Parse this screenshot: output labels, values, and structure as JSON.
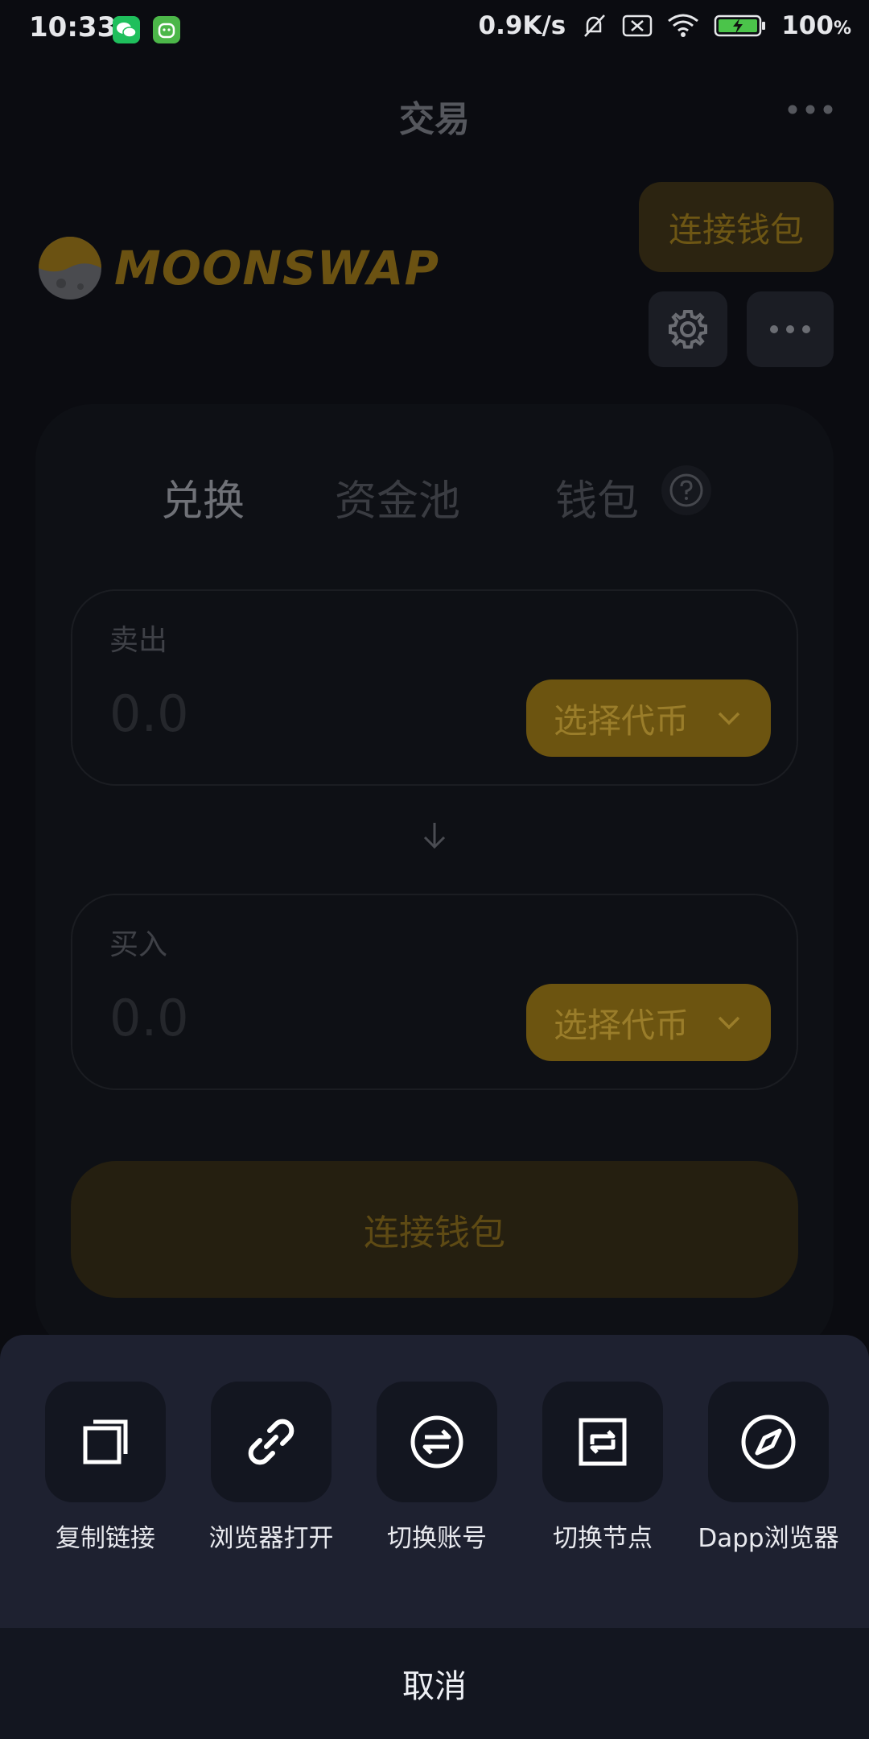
{
  "status_bar": {
    "time": "10:33",
    "network_speed": "0.9K/s",
    "battery": "100",
    "battery_unit": "%",
    "icons": [
      "wechat-icon",
      "app-icon",
      "mute-icon",
      "sim-off-icon",
      "wifi-icon",
      "battery-icon"
    ]
  },
  "header": {
    "title": "交易",
    "more_icon": "more-dots-icon"
  },
  "dapp": {
    "logo_text": "MOONSWAP",
    "connect_wallet_top": "连接钱包",
    "settings_icon": "gear-icon",
    "more_icon": "more-dots-icon"
  },
  "tabs": [
    {
      "label": "兑换",
      "active": true
    },
    {
      "label": "资金池",
      "active": false
    },
    {
      "label": "钱包",
      "active": false
    }
  ],
  "sell": {
    "label": "卖出",
    "amount_placeholder": "0.0",
    "select_token": "选择代币"
  },
  "buy": {
    "label": "买入",
    "amount_placeholder": "0.0",
    "select_token": "选择代币"
  },
  "connect_wallet_main": "连接钱包",
  "sheet": {
    "actions": [
      {
        "label": "复制链接",
        "icon": "copy-icon"
      },
      {
        "label": "浏览器打开",
        "icon": "link-icon"
      },
      {
        "label": "切换账号",
        "icon": "switch-account-icon"
      },
      {
        "label": "切换节点",
        "icon": "switch-node-icon"
      },
      {
        "label": "Dapp浏览器",
        "icon": "compass-icon"
      }
    ],
    "cancel": "取消"
  },
  "colors": {
    "accent_dim": "#6c5410",
    "sheet_bg": "#1e2130",
    "background": "#0b0c11"
  }
}
